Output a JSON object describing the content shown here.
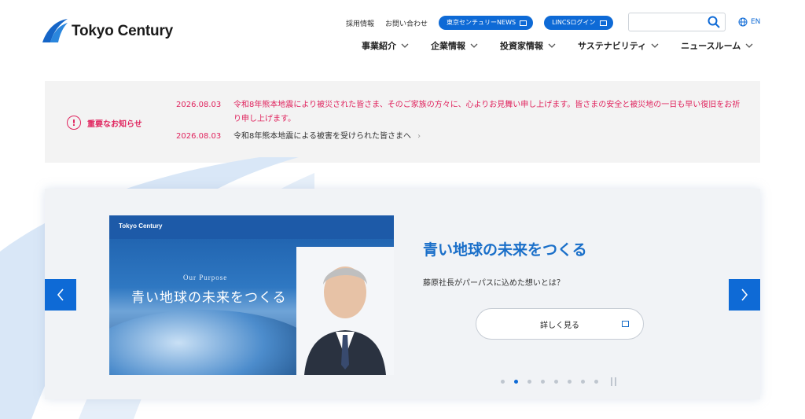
{
  "header": {
    "logo_text": "Tokyo Century",
    "utility_links": [
      "採用情報",
      "お問い合わせ"
    ],
    "pill_buttons": [
      "東京センチュリーNEWS",
      "LINCSログイン"
    ],
    "search_placeholder": "",
    "lang": "EN",
    "nav": [
      "事業紹介",
      "企業情報",
      "投資家情報",
      "サステナビリティ",
      "ニュースルーム"
    ]
  },
  "notice": {
    "label": "重要なお知らせ",
    "items": [
      {
        "date": "2026.08.03",
        "text": "令和8年熊本地震により被災された皆さま、そのご家族の方々に、心よりお見舞い申し上げます。皆さまの安全と被災地の一日も早い復旧をお祈り申し上げます。"
      },
      {
        "date": "2026.08.03",
        "text": "令和8年熊本地震による被害を受けられた皆さまへ"
      }
    ]
  },
  "carousel": {
    "image": {
      "brand": "Tokyo Century",
      "purpose": "Our Purpose",
      "motto": "青い地球の未来をつくる"
    },
    "title": "青い地球の未来をつくる",
    "subtitle": "藤原社長がパーパスに込めた想いとは？",
    "button": "詳しく見る",
    "dots": 8,
    "active_dot": 2
  },
  "colors": {
    "accent": "#0e6ad6",
    "alert": "#e0245e",
    "title": "#1a6fc9"
  }
}
